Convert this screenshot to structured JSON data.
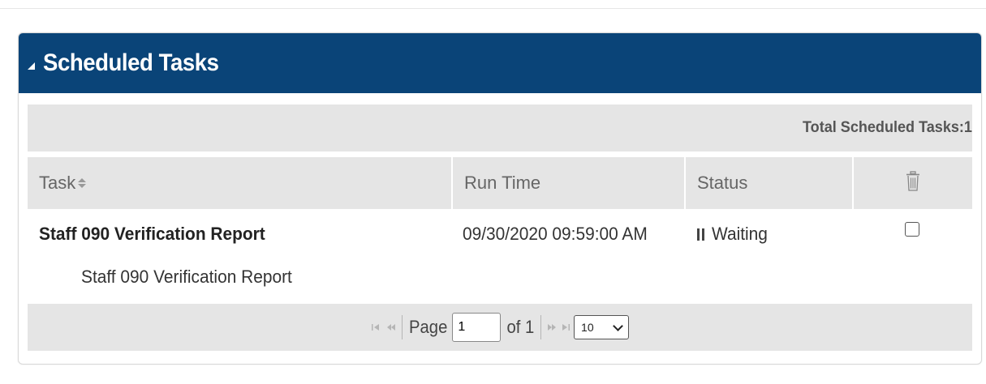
{
  "panel": {
    "title": "Scheduled Tasks"
  },
  "summary": {
    "text": "Total Scheduled Tasks:1"
  },
  "grid": {
    "columns": {
      "task": "Task",
      "run_time": "Run Time",
      "status": "Status"
    },
    "rows": [
      {
        "task_name": "Staff 090 Verification Report",
        "task_description": "Staff 090 Verification Report",
        "run_time": "09/30/2020 09:59:00 AM",
        "status": "Waiting",
        "status_icon": "pause-icon",
        "selected": false
      }
    ]
  },
  "pager": {
    "page_label": "Page",
    "page_value": "1",
    "of_label": "of 1",
    "page_size": "10"
  },
  "colors": {
    "header_bg": "#0a4478",
    "bar_bg": "#e5e5e5"
  }
}
